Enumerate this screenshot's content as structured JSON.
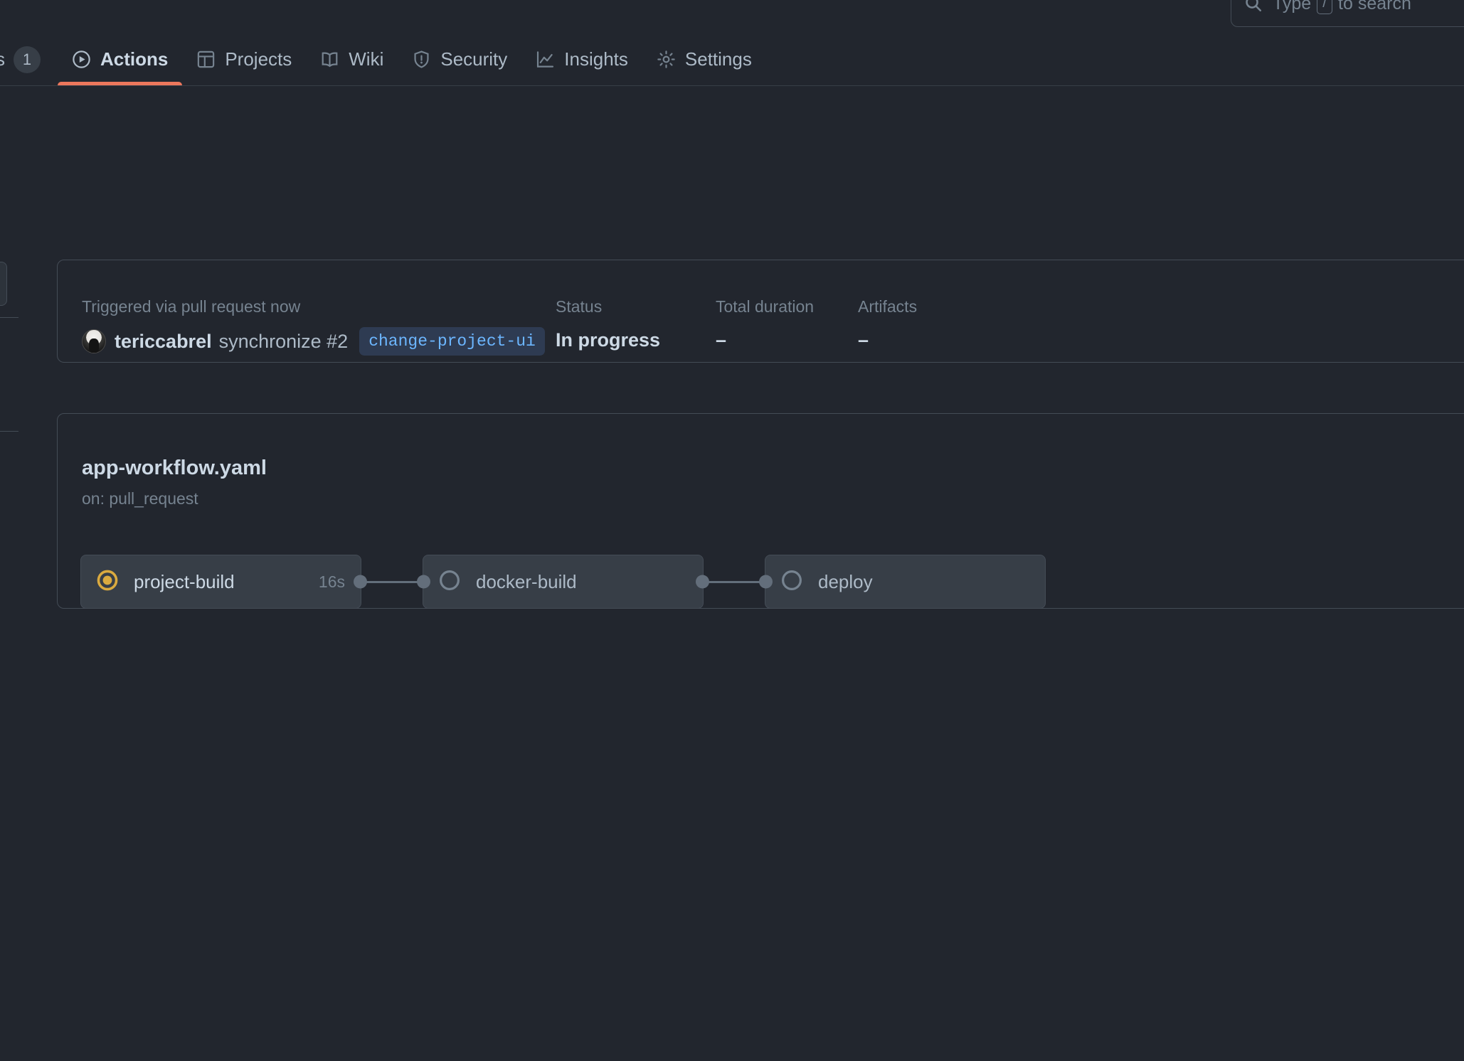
{
  "search": {
    "placeholder": "Type / to search",
    "key_hint": "/",
    "icon": "search-icon"
  },
  "nav": {
    "preceding_tab_fragment": "s",
    "counter_badge": "1",
    "tabs": [
      {
        "label": "Actions",
        "icon": "play-circle-icon",
        "active": true
      },
      {
        "label": "Projects",
        "icon": "table-icon",
        "active": false
      },
      {
        "label": "Wiki",
        "icon": "book-icon",
        "active": false
      },
      {
        "label": "Security",
        "icon": "shield-icon",
        "active": false
      },
      {
        "label": "Insights",
        "icon": "graph-icon",
        "active": false
      },
      {
        "label": "Settings",
        "icon": "gear-icon",
        "active": false
      }
    ],
    "active_underline_color": "#ec775c"
  },
  "summary": {
    "trigger_label": "Triggered via pull request now",
    "actor": "tericcabrel",
    "event": "synchronize #2",
    "branch": "change-project-ui",
    "branch_color": "#6cb6ff",
    "status_label": "Status",
    "status_value": "In progress",
    "duration_label": "Total duration",
    "duration_value": "–",
    "artifacts_label": "Artifacts",
    "artifacts_value": "–"
  },
  "workflow": {
    "file_name": "app-workflow.yaml",
    "trigger": "on: pull_request",
    "jobs": [
      {
        "name": "project-build",
        "status": "in_progress",
        "status_icon": "in-progress-donut-icon",
        "duration": "16s",
        "status_color": "#daaa3f"
      },
      {
        "name": "docker-build",
        "status": "pending",
        "status_icon": "pending-circle-icon",
        "duration": "",
        "status_color": "#768390"
      },
      {
        "name": "deploy",
        "status": "pending",
        "status_icon": "pending-circle-icon",
        "duration": "",
        "status_color": "#768390"
      }
    ]
  },
  "theme": {
    "background": "#22262e",
    "card_bg": "#22262e",
    "border": "#444c56",
    "node_bg": "#373e47",
    "text_primary": "#cdd9e5",
    "text_muted": "#768390"
  }
}
